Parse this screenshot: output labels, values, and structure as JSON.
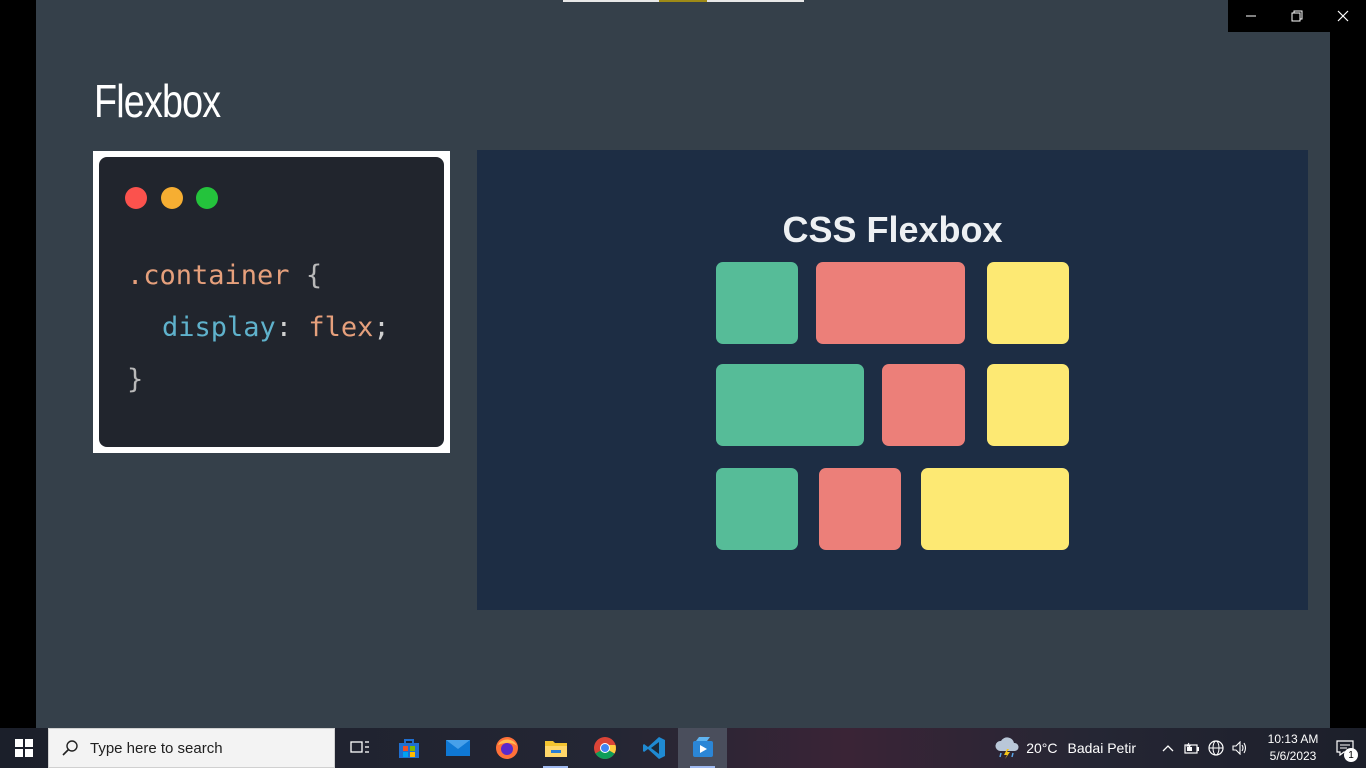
{
  "slide": {
    "title": "Flexbox",
    "code": {
      "line1_selector": ".container",
      "line1_brace": " {",
      "line2_prop": "display",
      "line2_colon": ": ",
      "line2_value": "flex",
      "line2_semi": ";",
      "line3_brace": "}"
    },
    "illustration": {
      "title": "CSS Flexbox",
      "colors": {
        "green": "#56bc98",
        "red": "#ec7f79",
        "yellow": "#fde973",
        "background": "#1d2d44"
      }
    }
  },
  "window": {
    "minimize_icon": "minimize-icon",
    "restore_icon": "restore-icon",
    "close_icon": "close-icon"
  },
  "taskbar": {
    "search_placeholder": "Type here to search",
    "apps": [
      "task-view-icon",
      "microsoft-store-icon",
      "mail-icon",
      "firefox-icon",
      "file-explorer-icon",
      "chrome-icon",
      "vscode-icon",
      "media-player-icon"
    ],
    "weather_temp": "20°C",
    "weather_desc": "Badai Petir",
    "time": "10:13 AM",
    "date": "5/6/2023",
    "notification_count": "1"
  }
}
